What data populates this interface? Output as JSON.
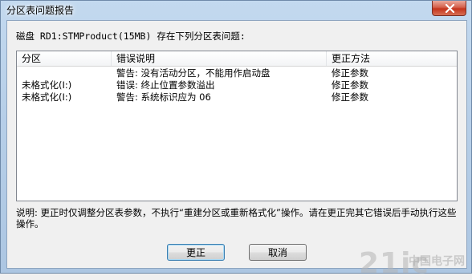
{
  "window": {
    "title": "分区表问题报告"
  },
  "heading": "磁盘 RD1:STMProduct(15MB) 存在下列分区表问题:",
  "table": {
    "columns": [
      "分区",
      "错误说明",
      "更正方法"
    ],
    "rows": [
      {
        "partition": "",
        "description": "警告: 没有活动分区，不能用作启动盘",
        "fix": "修正参数"
      },
      {
        "partition": "未格式化(I:)",
        "description": "错误: 终止位置参数溢出",
        "fix": "修正参数"
      },
      {
        "partition": "未格式化(I:)",
        "description": "警告: 系统标识应为 06",
        "fix": "修正参数"
      }
    ]
  },
  "note": "说明: 更正时仅调整分区表参数，不执行“重建分区或重新格式化”操作。请在更正完其它错误后手动执行这些操作。",
  "buttons": {
    "ok": "更正",
    "cancel": "取消"
  },
  "watermark": {
    "logo": "21ic",
    "text": "中国电子网"
  },
  "colors": {
    "close_button": "#c5341c",
    "title_bar": "#b7cfe8",
    "dialog_bg": "#f0f0f0"
  }
}
